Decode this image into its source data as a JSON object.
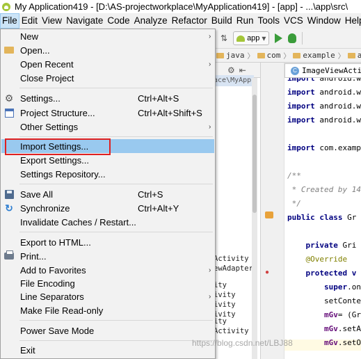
{
  "window": {
    "title": "My Application419 - [D:\\AS-projectworkplace\\MyApplication419] - [app] - ...\\app\\src\\"
  },
  "menubar": {
    "items": [
      "File",
      "Edit",
      "View",
      "Navigate",
      "Code",
      "Analyze",
      "Refactor",
      "Build",
      "Run",
      "Tools",
      "VCS",
      "Window",
      "Help"
    ],
    "active": "File"
  },
  "toolbar": {
    "run_config": "app"
  },
  "breadcrumb": {
    "items": [
      "java",
      "com",
      "example",
      "a"
    ]
  },
  "project_panel": {
    "path_fragment": "ace\\MyApp",
    "tree_fragments": [
      "Activity",
      "ewAdapter",
      "ity",
      "ivity",
      "ivity",
      "ivity",
      "ity",
      "Activity"
    ]
  },
  "editor": {
    "tab_label": "ImageViewActivity.j",
    "code_lines": [
      [
        "import android.w",
        ""
      ],
      [
        "import android.w",
        ""
      ],
      [
        "import android.w",
        ""
      ],
      [
        "import android.w",
        ""
      ],
      [
        "import com.examp",
        ""
      ],
      [
        "/**",
        ""
      ],
      [
        " * Created by 14",
        ""
      ],
      [
        " */",
        ""
      ],
      [
        "public class Gr",
        ""
      ],
      [
        "    private Gri",
        ""
      ],
      [
        "    @Override",
        ""
      ],
      [
        "    protected v",
        ""
      ],
      [
        "        super.on",
        ""
      ],
      [
        "        setConten",
        ""
      ],
      [
        "        mGv= (Gr",
        ""
      ],
      [
        "        mGv.setA",
        ""
      ],
      [
        "        mGv.setO",
        ""
      ]
    ]
  },
  "file_menu": {
    "items": [
      {
        "label": "New",
        "shortcut": "",
        "submenu": true,
        "icon": ""
      },
      {
        "label": "Open...",
        "shortcut": "",
        "submenu": false,
        "icon": "folder-icon"
      },
      {
        "label": "Open Recent",
        "shortcut": "",
        "submenu": true,
        "icon": ""
      },
      {
        "label": "Close Project",
        "shortcut": "",
        "submenu": false,
        "icon": ""
      },
      {
        "label": "Settings...",
        "shortcut": "Ctrl+Alt+S",
        "submenu": false,
        "icon": "settings-icon"
      },
      {
        "label": "Project Structure...",
        "shortcut": "Ctrl+Alt+Shift+S",
        "submenu": false,
        "icon": "project-structure-icon"
      },
      {
        "label": "Other Settings",
        "shortcut": "",
        "submenu": true,
        "icon": ""
      },
      {
        "label": "Import Settings...",
        "shortcut": "",
        "submenu": false,
        "icon": ""
      },
      {
        "label": "Export Settings...",
        "shortcut": "",
        "submenu": false,
        "icon": ""
      },
      {
        "label": "Settings Repository...",
        "shortcut": "",
        "submenu": false,
        "icon": ""
      },
      {
        "label": "Save All",
        "shortcut": "Ctrl+S",
        "submenu": false,
        "icon": "save-icon"
      },
      {
        "label": "Synchronize",
        "shortcut": "Ctrl+Alt+Y",
        "submenu": false,
        "icon": "sync-icon"
      },
      {
        "label": "Invalidate Caches / Restart...",
        "shortcut": "",
        "submenu": false,
        "icon": ""
      },
      {
        "label": "Export to HTML...",
        "shortcut": "",
        "submenu": false,
        "icon": ""
      },
      {
        "label": "Print...",
        "shortcut": "",
        "submenu": false,
        "icon": "print-icon"
      },
      {
        "label": "Add to Favorites",
        "shortcut": "",
        "submenu": true,
        "icon": ""
      },
      {
        "label": "File Encoding",
        "shortcut": "",
        "submenu": false,
        "icon": ""
      },
      {
        "label": "Line Separators",
        "shortcut": "",
        "submenu": true,
        "icon": ""
      },
      {
        "label": "Make File Read-only",
        "shortcut": "",
        "submenu": false,
        "icon": ""
      },
      {
        "label": "Power Save Mode",
        "shortcut": "",
        "submenu": false,
        "icon": ""
      },
      {
        "label": "Exit",
        "shortcut": "",
        "submenu": false,
        "icon": ""
      }
    ],
    "highlighted": "Import Settings..."
  },
  "watermark": "https://blog.csdn.net/LBJ88"
}
